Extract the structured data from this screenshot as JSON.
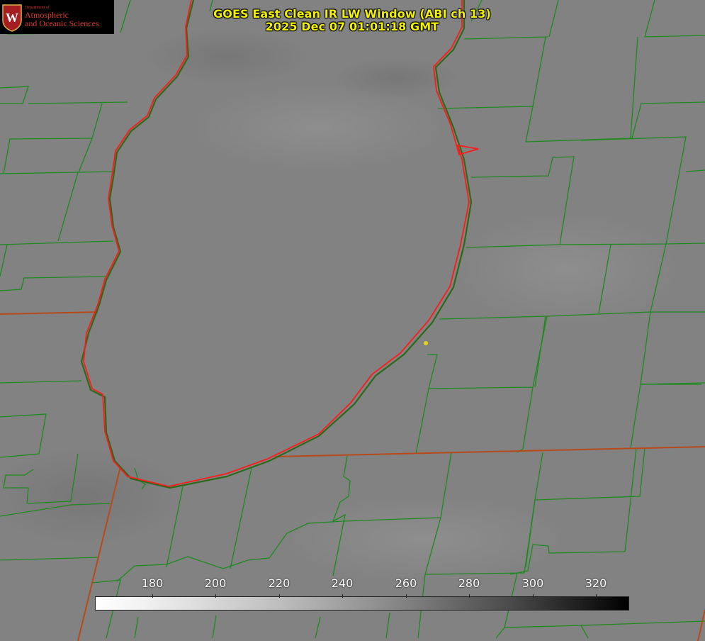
{
  "logo": {
    "department": "Department of",
    "line1": "Atmospheric",
    "line2": "and Oceanic Sciences",
    "seal_letter": "W"
  },
  "title": {
    "line1": "GOES East Clean IR LW Window (ABI ch 13)",
    "line2": "2025 Dec 07 01:01:18 GMT"
  },
  "colorbar": {
    "ticks": [
      "180",
      "200",
      "220",
      "240",
      "260",
      "280",
      "300",
      "320"
    ],
    "gradient": "white-to-black",
    "range": [
      162,
      330
    ]
  },
  "colors": {
    "county_lines": "#1d8a1d",
    "state_lines": "#b84a1a",
    "shoreline": "#ff1a1a",
    "marker": "#e6d21a",
    "title_text": "#f2f200"
  }
}
